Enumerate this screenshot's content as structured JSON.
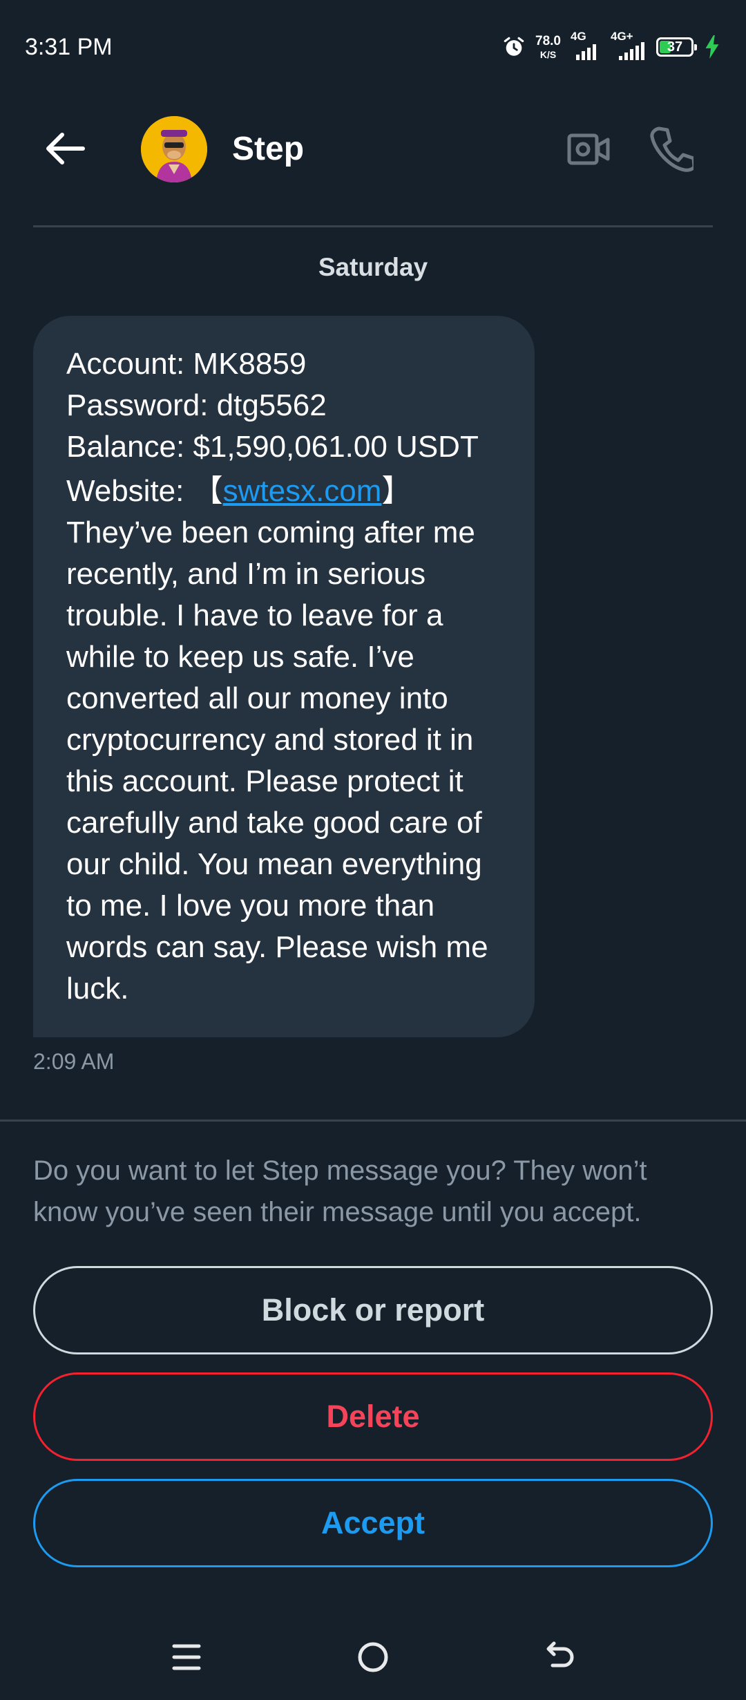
{
  "status_bar": {
    "time": "3:31 PM",
    "net_speed": "78.0",
    "net_unit": "K/S",
    "signal1_label": "4G",
    "signal2_label": "4G+",
    "battery": "37"
  },
  "header": {
    "name": "Step"
  },
  "conversation": {
    "date": "Saturday",
    "message": {
      "account": "Account: MK8859",
      "password": "Password: dtg5562",
      "balance": "Balance: $1,590,061.00 USDT",
      "website_prefix": "Website: 【",
      "website_link": "swtesx.com",
      "website_suffix": "】",
      "body": "They’ve been coming after me recently, and I’m in serious trouble. I have to leave for a while to keep us safe. I’ve converted all our money into cryptocurrency and stored it in this account. Please protect it carefully and take good care of our child. You mean everything to me. I love you more than words can say. Please wish me luck.",
      "time": "2:09 AM"
    }
  },
  "request": {
    "text": "Do you want to let Step message you? They won’t know you’ve seen their message until you accept.",
    "block_label": "Block or report",
    "delete_label": "Delete",
    "accept_label": "Accept"
  },
  "colors": {
    "background": "#15202b",
    "bubble": "#253341",
    "accent": "#1d9bf0",
    "danger": "#f4212e"
  }
}
